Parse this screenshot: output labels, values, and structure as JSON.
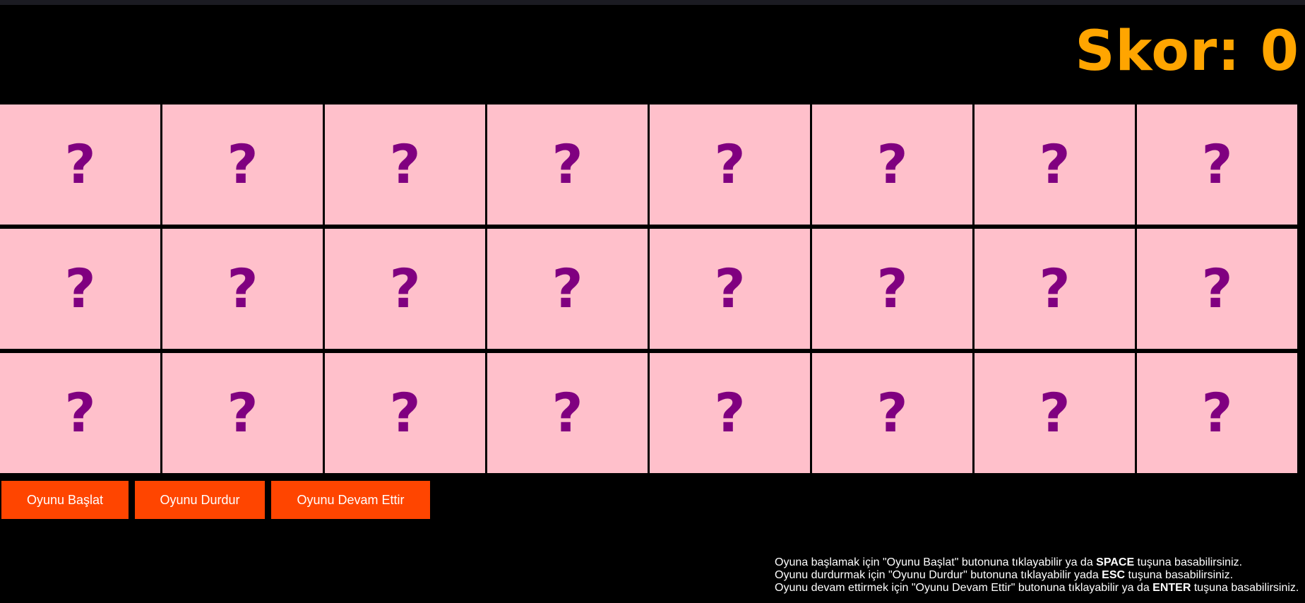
{
  "score": {
    "text": "Skor: 0"
  },
  "board": {
    "rows": 3,
    "columns": 8,
    "card_face": "?",
    "card_color": "#ffc0cb",
    "mark_color": "#800080"
  },
  "controls": {
    "start_label": "Oyunu Başlat",
    "pause_label": "Oyunu Durdur",
    "resume_label": "Oyunu Devam Ettir",
    "button_color": "#ff4500"
  },
  "help": {
    "line1": {
      "before": "Oyuna başlamak için \"Oyunu Başlat\" butonuna tıklayabilir ya da ",
      "key": "SPACE",
      "after": " tuşuna basabilirsiniz."
    },
    "line2": {
      "before": "Oyunu durdurmak için \"Oyunu Durdur\" butonuna tıklayabilir yada ",
      "key": "ESC",
      "after": " tuşuna basabilirsiniz."
    },
    "line3": {
      "before": "Oyunu devam ettirmek için \"Oyunu Devam Ettir\" butonuna tıklayabilir ya da ",
      "key": "ENTER",
      "after": " tuşuna basabilirsiniz."
    }
  },
  "colors": {
    "background": "#000000",
    "score": "#ffa500",
    "topbar": "#1b1b22"
  }
}
